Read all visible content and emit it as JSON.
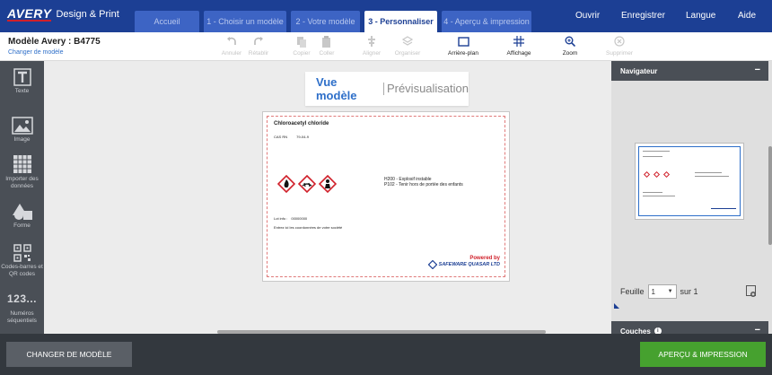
{
  "header": {
    "logo_mark": "AVERY",
    "logo_text": "Design & Print",
    "steps": [
      {
        "label": "Accueil"
      },
      {
        "label": "1 - Choisir un modèle"
      },
      {
        "label": "2 - Votre modèle"
      },
      {
        "label": "3 - Personnaliser"
      },
      {
        "label": "4 - Aperçu & impression"
      }
    ],
    "active_step": "3 - Personnaliser",
    "nav": {
      "open": "Ouvrir",
      "save": "Enregistrer",
      "language": "Langue",
      "help": "Aide"
    }
  },
  "toolbar": {
    "model_title": "Modèle Avery : B4775",
    "change_model_link": "Changer de modèle",
    "undo": "Annuler",
    "redo": "Rétablir",
    "copy": "Copier",
    "paste": "Coller",
    "align": "Aligner",
    "organize": "Organiser",
    "background": "Arrière-plan",
    "display": "Affichage",
    "zoom": "Zoom",
    "delete": "Supprimer"
  },
  "sidebar": {
    "items": [
      {
        "label": "Texte"
      },
      {
        "label": "Image"
      },
      {
        "label": "Importer des données"
      },
      {
        "label": "Forme"
      },
      {
        "label": "Codes-barres et QR codes"
      },
      {
        "label": "Numéros séquentiels"
      }
    ],
    "numbers_glyph": "123..."
  },
  "view_tabs": {
    "model": "Vue modèle",
    "preview": "Prévisualisation"
  },
  "label": {
    "name": "Chloroacetyl chloride",
    "cas_label": "CAS RN",
    "cas_value": "79-04-9",
    "hazard_1": "H200 - Explosif instable",
    "hazard_2": "P102 - Tenir hors de portée des enfants",
    "lot_label": "Lot info :",
    "lot_value": "00000000",
    "coords": "Entrez ici les coordonnées de votre société",
    "powered_by": "Powered by",
    "brand": "SAFEWARE QUASAR LTD"
  },
  "navigator": {
    "title": "Navigateur",
    "sheet_label": "Feuille",
    "sheet_value": "1",
    "sheet_of": "sur 1"
  },
  "layers": {
    "title": "Couches"
  },
  "bottom": {
    "change_model": "CHANGER DE MODÈLE",
    "preview_print": "APERÇU & IMPRESSION"
  },
  "colors": {
    "brand_blue": "#1c3f94",
    "step_blue": "#3d64c4",
    "green": "#46a12f",
    "hazard_red": "#d0202a",
    "dark_panel": "#4a4f56"
  }
}
